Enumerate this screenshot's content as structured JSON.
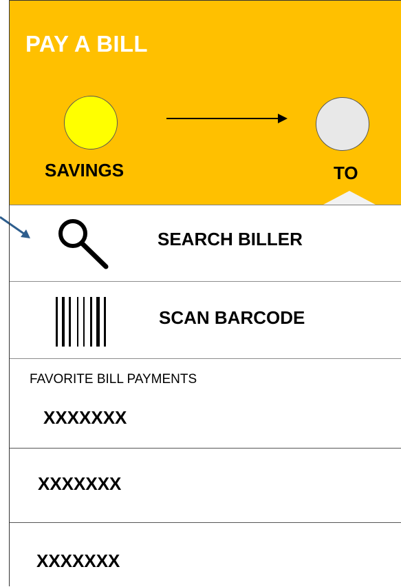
{
  "header": {
    "title": "PAY A BILL",
    "from_label": "SAVINGS",
    "to_label": "TO"
  },
  "actions": {
    "search_label": "SEARCH BILLER",
    "scan_label": "SCAN BARCODE"
  },
  "favorites": {
    "heading": "FAVORITE BILL PAYMENTS",
    "items": [
      {
        "name": "XXXXXXX"
      },
      {
        "name": "XXXXXXX"
      },
      {
        "name": "XXXXXXX"
      }
    ]
  },
  "colors": {
    "header_bg": "#ffc000",
    "from_circle": "#ffff00",
    "to_circle": "#e8e8e8",
    "pointer_arrow": "#2e5e8e"
  },
  "icons": {
    "search": "magnifier-icon",
    "scan": "barcode-icon",
    "transfer": "right-arrow-icon"
  }
}
